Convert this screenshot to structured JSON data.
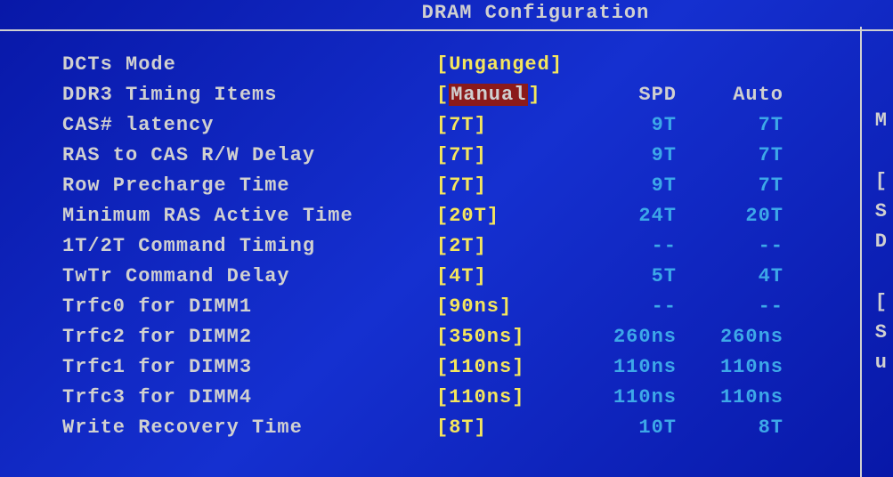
{
  "title": "DRAM Configuration",
  "headers": {
    "spd": "SPD",
    "auto": "Auto"
  },
  "rows": [
    {
      "label": "DCTs Mode",
      "value": "[Unganged]",
      "spd": "",
      "auto": "",
      "side": ""
    },
    {
      "label": "DDR3 Timing Items",
      "value_pre": "[",
      "value_sel": "Manual",
      "value_post": "]",
      "spd_hdr": true,
      "side": ""
    },
    {
      "label": "CAS# latency",
      "value": "[7T]",
      "spd": "9T",
      "auto": "7T",
      "side": "M"
    },
    {
      "label": "RAS to CAS R/W Delay",
      "value": "[7T]",
      "spd": "9T",
      "auto": "7T",
      "side": ""
    },
    {
      "label": "Row Precharge Time",
      "value": "[7T]",
      "spd": "9T",
      "auto": "7T",
      "side": "["
    },
    {
      "label": "Minimum RAS Active Time",
      "value": "[20T]",
      "spd": "24T",
      "auto": "20T",
      "side": "S"
    },
    {
      "label": "1T/2T Command Timing",
      "value": "[2T]",
      "spd": "--",
      "auto": "--",
      "side": "D"
    },
    {
      "label": "TwTr Command Delay",
      "value": "[4T]",
      "spd": "5T",
      "auto": "4T",
      "side": ""
    },
    {
      "label": "Trfc0 for DIMM1",
      "value": "[90ns]",
      "spd": "--",
      "auto": "--",
      "side": "["
    },
    {
      "label": "Trfc2 for DIMM2",
      "value": "[350ns]",
      "spd": "260ns",
      "auto": "260ns",
      "side": "S"
    },
    {
      "label": "Trfc1 for DIMM3",
      "value": "[110ns]",
      "spd": "110ns",
      "auto": "110ns",
      "side": "u"
    },
    {
      "label": "Trfc3 for DIMM4",
      "value": "[110ns]",
      "spd": "110ns",
      "auto": "110ns",
      "side": ""
    },
    {
      "label": "Write Recovery Time",
      "value": "[8T]",
      "spd": "10T",
      "auto": "8T",
      "side": ""
    }
  ]
}
